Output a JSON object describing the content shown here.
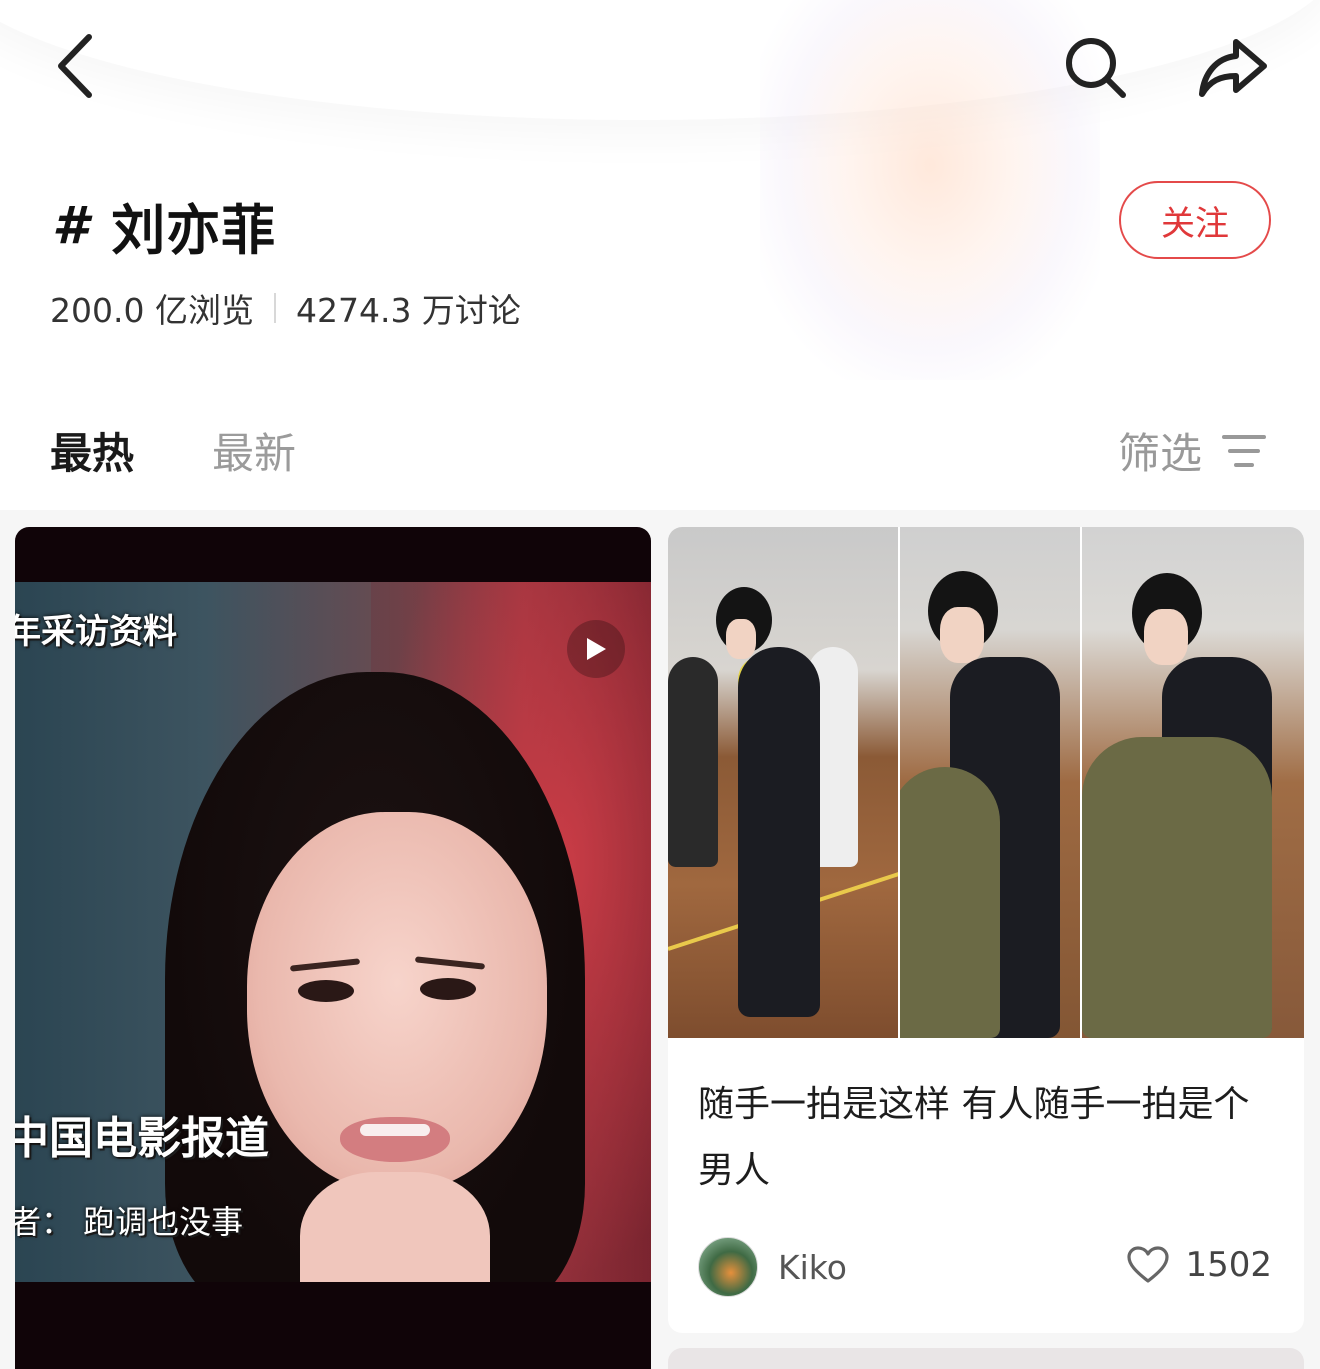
{
  "header": {
    "topic_hash": "#",
    "topic_name": "刘亦菲",
    "follow_label": "关注",
    "views": "200.0 亿浏览",
    "discussions": "4274.3 万讨论"
  },
  "tabs": [
    {
      "label": "最热",
      "active": true
    },
    {
      "label": "最新",
      "active": false
    }
  ],
  "filter": {
    "label": "筛选"
  },
  "icons": {
    "back": "chevron-left-icon",
    "search": "search-icon",
    "share": "share-icon",
    "filter": "filter-lines-icon",
    "play": "play-icon",
    "heart": "heart-icon"
  },
  "colors": {
    "accent_red": "#e0383a",
    "text_primary": "#1d1d1d",
    "text_muted": "#999999"
  },
  "feed": {
    "left_card": {
      "overlay_top": "年采访资料",
      "overlay_middle": "中国电影报道",
      "overlay_bottom": "者： 跑调也没事"
    },
    "right_card": {
      "title": "随手一拍是这样 有人随手一拍是个男人",
      "author": "Kiko",
      "likes": "1502"
    }
  }
}
